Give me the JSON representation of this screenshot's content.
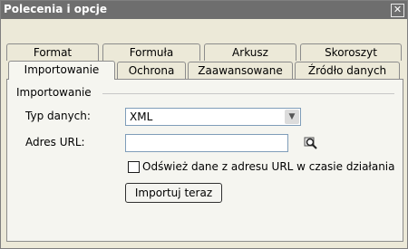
{
  "window": {
    "title": "Polecenia i opcje",
    "close_glyph": "✕"
  },
  "tabs_row1": [
    "Format",
    "Formuła",
    "Arkusz",
    "Skoroszyt"
  ],
  "tabs_row2": [
    "Importowanie",
    "Ochrona",
    "Zaawansowane",
    "Źródło danych"
  ],
  "active_tab": "Importowanie",
  "panel": {
    "group_label": "Importowanie",
    "data_type_label": "Typ danych:",
    "data_type_value": "XML",
    "url_label": "Adres URL:",
    "url_value": "",
    "refresh_checkbox_label": "Odśwież dane z adresu URL w czasie działania",
    "refresh_checked": false,
    "import_button": "Importuj teraz"
  },
  "icons": {
    "dropdown": "chevron-down-icon",
    "browse": "magnifier-icon",
    "close": "close-icon"
  }
}
